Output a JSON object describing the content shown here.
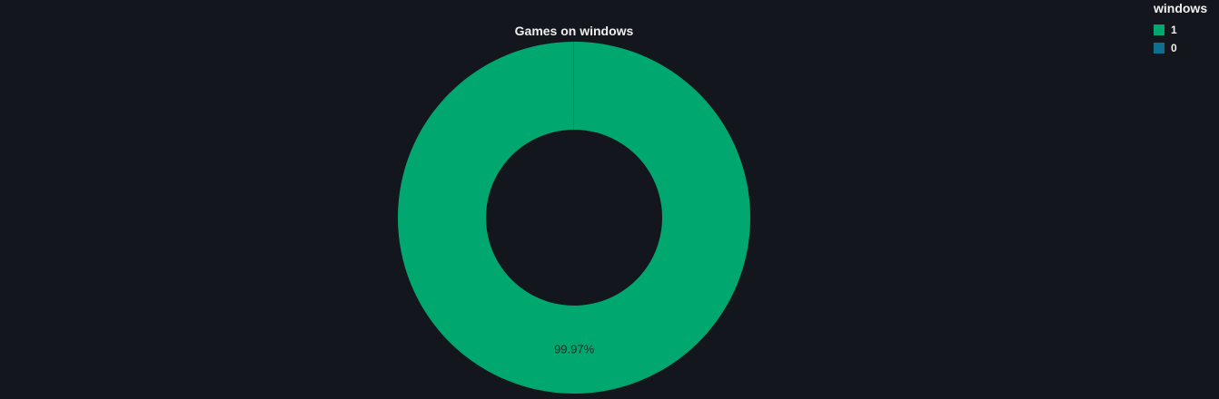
{
  "chart_data": {
    "type": "pie",
    "title": "Games on windows",
    "legend_title": "windows",
    "legend_position": "top-right",
    "hole": true,
    "slices": [
      {
        "label": "1",
        "percent": 99.97,
        "percent_label": "99.97%",
        "color": "#00a86f"
      },
      {
        "label": "0",
        "percent": 0.03,
        "percent_label": "",
        "color": "#0f6f8f"
      }
    ]
  }
}
